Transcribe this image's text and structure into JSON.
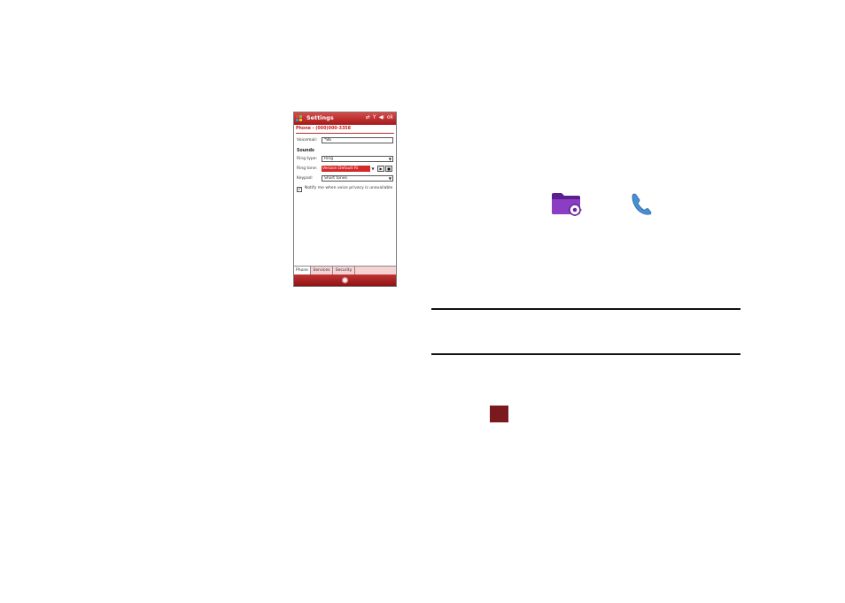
{
  "phone": {
    "title": "Settings",
    "ok_label": "ok",
    "header": "Phone - (000)000-3358",
    "voicemail": {
      "label": "Voicemail:",
      "value": "*86"
    },
    "sounds_heading": "Sounds",
    "ring_type": {
      "label": "Ring type:",
      "value": "Ring"
    },
    "ring_tone": {
      "label": "Ring tone:",
      "value": "Verizon Default Ri"
    },
    "keypad": {
      "label": "Keypad:",
      "value": "Short tones"
    },
    "notify_text": "Notify me when voice privacy is unavailable",
    "tabs": [
      "Phone",
      "Services",
      "Security"
    ]
  },
  "icons": {
    "settings_folder": "settings-folder-icon",
    "phone": "phone-handset-icon",
    "end_key": "square-key-icon"
  },
  "colors": {
    "accent_red": "#b21d1d",
    "folder_purple": "#7a2fb0",
    "phone_blue": "#4a8fd0",
    "key_maroon": "#7a1a1f"
  }
}
